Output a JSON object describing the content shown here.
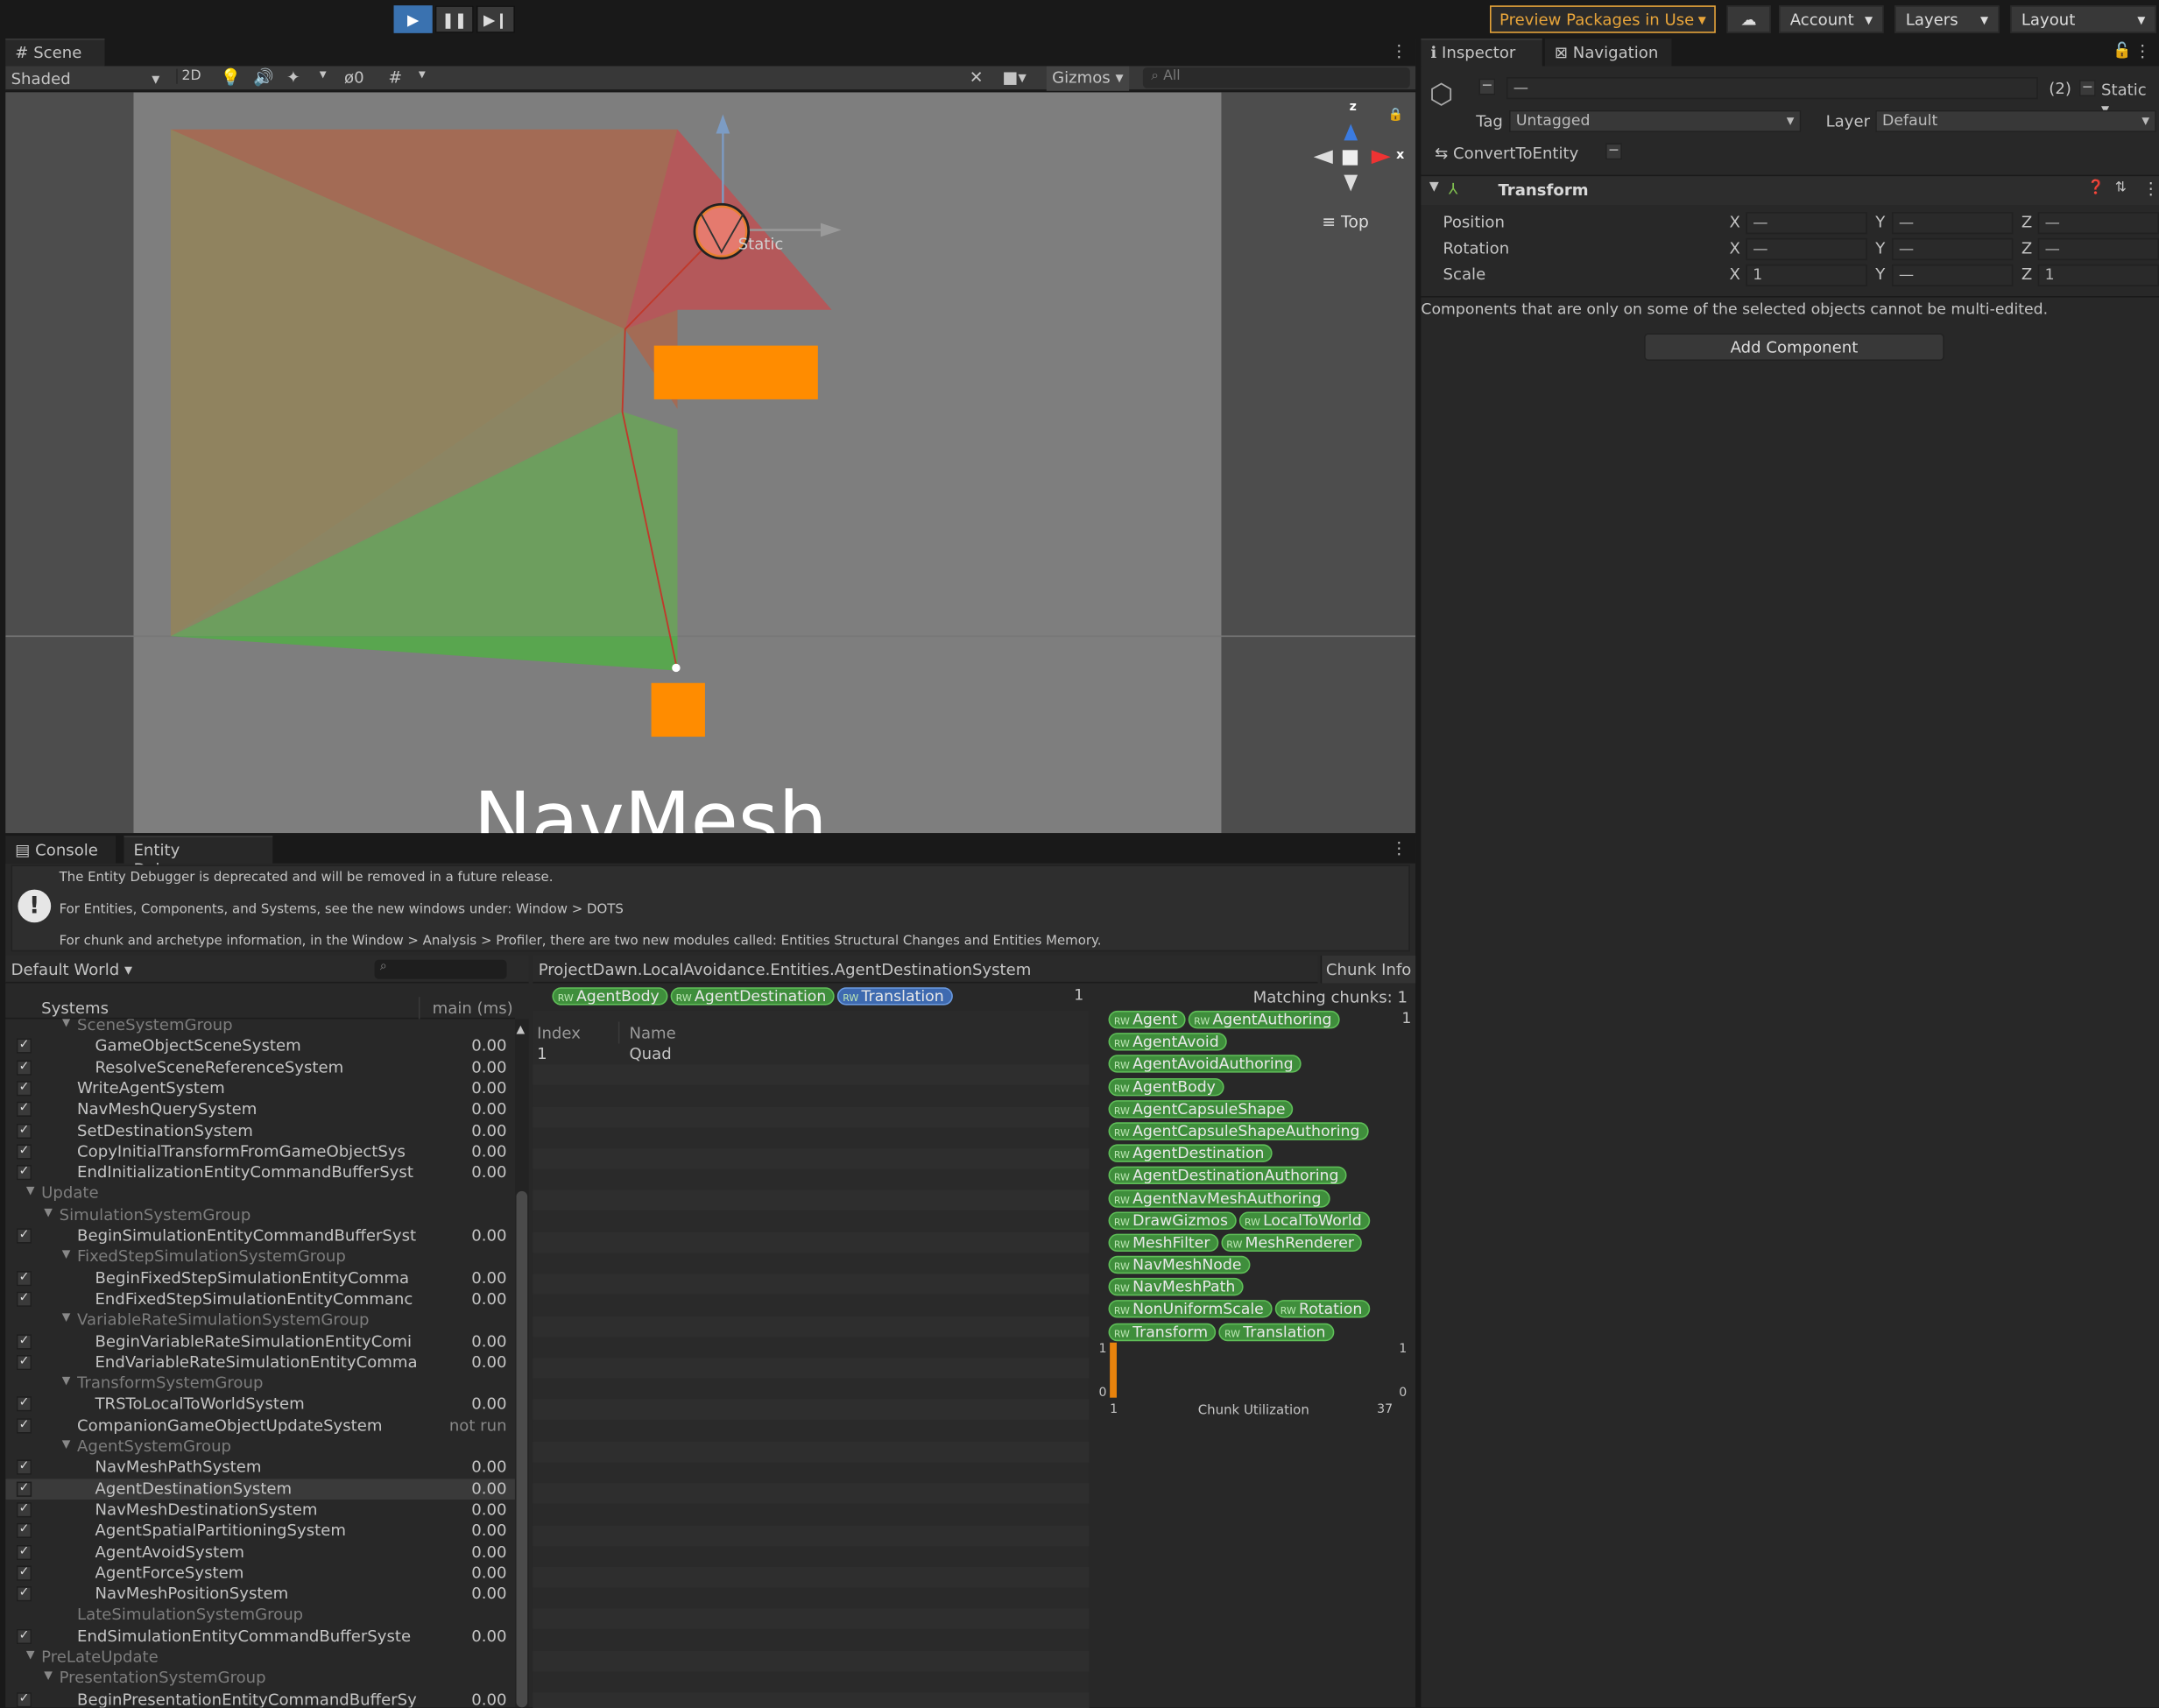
{
  "toolbar": {
    "preview_packages": "Preview Packages in Use",
    "account": "Account",
    "layers": "Layers",
    "layout": "Layout"
  },
  "scene": {
    "tab_label": "Scene",
    "draw_mode": "Shaded",
    "mode_2d": "2D",
    "hidden_count": "0",
    "gizmos": "Gizmos",
    "search_placeholder": "All",
    "view_label": "Top",
    "static_label": "Static",
    "bottom_text": "NavMesh",
    "axis_z": "z",
    "axis_x": "x"
  },
  "inspector": {
    "tab_inspector": "Inspector",
    "tab_navigation": "Navigation",
    "name_value": "—",
    "count": "(2)",
    "static_label": "Static",
    "tag_label": "Tag",
    "tag_value": "Untagged",
    "layer_label": "Layer",
    "layer_value": "Default",
    "convert_label": "ConvertToEntity",
    "transform_title": "Transform",
    "position_label": "Position",
    "rotation_label": "Rotation",
    "scale_label": "Scale",
    "axis_x": "X",
    "axis_y": "Y",
    "axis_z": "Z",
    "position": [
      "—",
      "—",
      "—"
    ],
    "rotation": [
      "—",
      "—",
      "—"
    ],
    "scale": [
      "1",
      "—",
      "1"
    ],
    "multi_edit_note": "Components that are only on some of the selected objects cannot be multi-edited.",
    "add_component": "Add Component"
  },
  "bottom": {
    "tab_console": "Console",
    "tab_entity_debugger": "Entity Debugger",
    "warning_line1": "The Entity Debugger is deprecated and will be removed in a future release.",
    "warning_line2": "For Entities, Components, and Systems, see the new windows under: Window > DOTS",
    "warning_line3": "For chunk and archetype information, in the Window > Analysis > Profiler, there are two new modules called: Entities Structural Changes and Entities Memory.",
    "world": "Default World",
    "systems_header": "Systems",
    "time_header": "main (ms)",
    "selected_system": "ProjectDawn.LocalAvoidance.Entities.AgentDestinationSystem",
    "chunk_info": "Chunk Info",
    "query_count": "1",
    "query_components": [
      "AgentBody",
      "AgentDestination",
      "Translation"
    ],
    "entity_columns": {
      "index": "Index",
      "name": "Name"
    },
    "entities": [
      {
        "index": "1",
        "name": "Quad"
      }
    ],
    "matching_chunks": "Matching chunks: 1",
    "archetype_count": "1",
    "archetype_components": [
      [
        "Agent",
        "AgentAuthoring"
      ],
      [
        "AgentAvoid"
      ],
      [
        "AgentAvoidAuthoring"
      ],
      [
        "AgentBody"
      ],
      [
        "AgentCapsuleShape"
      ],
      [
        "AgentCapsuleShapeAuthoring"
      ],
      [
        "AgentDestination"
      ],
      [
        "AgentDestinationAuthoring"
      ],
      [
        "AgentNavMeshAuthoring"
      ],
      [
        "DrawGizmos",
        "LocalToWorld"
      ],
      [
        "MeshFilter",
        "MeshRenderer"
      ],
      [
        "NavMeshNode"
      ],
      [
        "NavMeshPath"
      ],
      [
        "NonUniformScale",
        "Rotation"
      ],
      [
        "Transform",
        "Translation"
      ]
    ],
    "chunk_chart": {
      "y_top": "1",
      "y_bottom": "0",
      "x_left": "1",
      "x_right": "37",
      "right_top": "1",
      "right_bottom": "0",
      "label": "Chunk Utilization",
      "fill_fraction": 1.0
    },
    "systems": [
      {
        "name": "SceneSystemGroup",
        "time": "",
        "check": false,
        "group": true,
        "level": 2,
        "arrow": true
      },
      {
        "name": "GameObjectSceneSystem",
        "time": "0.00",
        "check": true,
        "group": false,
        "level": 3
      },
      {
        "name": "ResolveSceneReferenceSystem",
        "time": "0.00",
        "check": true,
        "group": false,
        "level": 3
      },
      {
        "name": "WriteAgentSystem",
        "time": "0.00",
        "check": true,
        "group": false,
        "level": 2
      },
      {
        "name": "NavMeshQuerySystem",
        "time": "0.00",
        "check": true,
        "group": false,
        "level": 2
      },
      {
        "name": "SetDestinationSystem",
        "time": "0.00",
        "check": true,
        "group": false,
        "level": 2
      },
      {
        "name": "CopyInitialTransformFromGameObjectSys",
        "time": "0.00",
        "check": true,
        "group": false,
        "level": 2
      },
      {
        "name": "EndInitializationEntityCommandBufferSyst",
        "time": "0.00",
        "check": true,
        "group": false,
        "level": 2
      },
      {
        "name": "Update",
        "time": "",
        "check": false,
        "group": true,
        "level": 0,
        "arrow": true
      },
      {
        "name": "SimulationSystemGroup",
        "time": "",
        "check": false,
        "group": true,
        "level": 1,
        "arrow": true
      },
      {
        "name": "BeginSimulationEntityCommandBufferSyst",
        "time": "0.00",
        "check": true,
        "group": false,
        "level": 2
      },
      {
        "name": "FixedStepSimulationSystemGroup",
        "time": "",
        "check": false,
        "group": true,
        "level": 2,
        "arrow": true
      },
      {
        "name": "BeginFixedStepSimulationEntityComma",
        "time": "0.00",
        "check": true,
        "group": false,
        "level": 3
      },
      {
        "name": "EndFixedStepSimulationEntityCommanc",
        "time": "0.00",
        "check": true,
        "group": false,
        "level": 3
      },
      {
        "name": "VariableRateSimulationSystemGroup",
        "time": "",
        "check": false,
        "group": true,
        "level": 2,
        "arrow": true
      },
      {
        "name": "BeginVariableRateSimulationEntityComi",
        "time": "0.00",
        "check": true,
        "group": false,
        "level": 3
      },
      {
        "name": "EndVariableRateSimulationEntityComma",
        "time": "0.00",
        "check": true,
        "group": false,
        "level": 3
      },
      {
        "name": "TransformSystemGroup",
        "time": "",
        "check": false,
        "group": true,
        "level": 2,
        "arrow": true
      },
      {
        "name": "TRSToLocalToWorldSystem",
        "time": "0.00",
        "check": true,
        "group": false,
        "level": 3
      },
      {
        "name": "CompanionGameObjectUpdateSystem",
        "time": "not run",
        "check": true,
        "group": false,
        "level": 2
      },
      {
        "name": "AgentSystemGroup",
        "time": "",
        "check": false,
        "group": true,
        "level": 2,
        "arrow": true
      },
      {
        "name": "NavMeshPathSystem",
        "time": "0.00",
        "check": true,
        "group": false,
        "level": 3
      },
      {
        "name": "AgentDestinationSystem",
        "time": "0.00",
        "check": true,
        "group": false,
        "level": 3,
        "selected": true
      },
      {
        "name": "NavMeshDestinationSystem",
        "time": "0.00",
        "check": true,
        "group": false,
        "level": 3
      },
      {
        "name": "AgentSpatialPartitioningSystem",
        "time": "0.00",
        "check": true,
        "group": false,
        "level": 3
      },
      {
        "name": "AgentAvoidSystem",
        "time": "0.00",
        "check": true,
        "group": false,
        "level": 3
      },
      {
        "name": "AgentForceSystem",
        "time": "0.00",
        "check": true,
        "group": false,
        "level": 3
      },
      {
        "name": "NavMeshPositionSystem",
        "time": "0.00",
        "check": true,
        "group": false,
        "level": 3
      },
      {
        "name": "LateSimulationSystemGroup",
        "time": "",
        "check": false,
        "group": true,
        "level": 2,
        "arrow": false
      },
      {
        "name": "EndSimulationEntityCommandBufferSyste",
        "time": "0.00",
        "check": true,
        "group": false,
        "level": 2
      },
      {
        "name": "PreLateUpdate",
        "time": "",
        "check": false,
        "group": true,
        "level": 0,
        "arrow": true
      },
      {
        "name": "PresentationSystemGroup",
        "time": "",
        "check": false,
        "group": true,
        "level": 1,
        "arrow": true
      },
      {
        "name": "BeginPresentationEntityCommandBufferSy",
        "time": "0.00",
        "check": true,
        "group": false,
        "level": 2
      }
    ]
  }
}
